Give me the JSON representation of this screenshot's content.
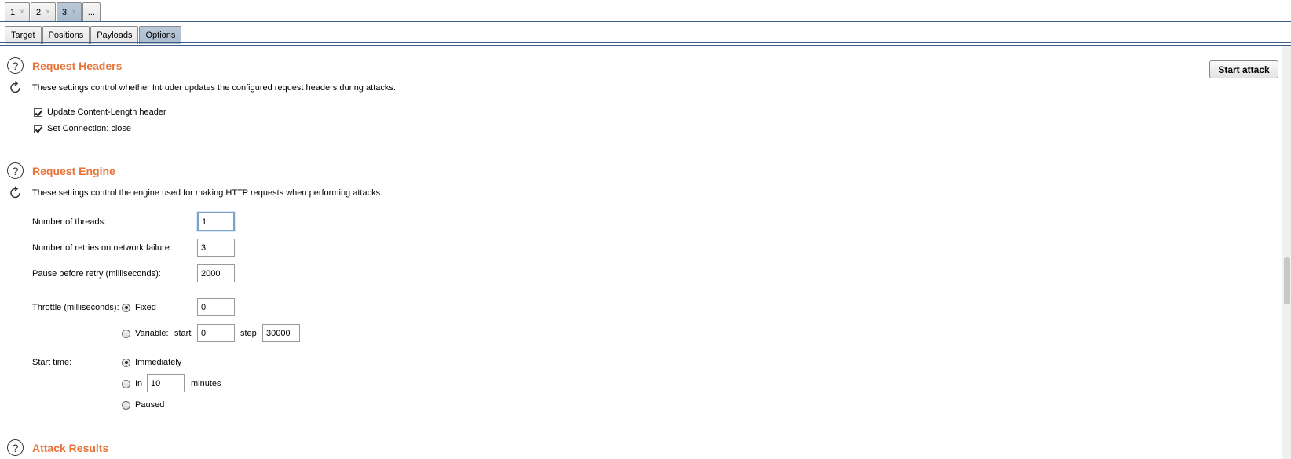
{
  "top_tabs": [
    {
      "label": "1",
      "close": "×"
    },
    {
      "label": "2",
      "close": "×"
    },
    {
      "label": "3",
      "close": "×"
    },
    {
      "label": "..."
    }
  ],
  "sub_tabs": [
    "Target",
    "Positions",
    "Payloads",
    "Options"
  ],
  "start_attack_label": "Start attack",
  "request_headers": {
    "title": "Request Headers",
    "description": "These settings control whether Intruder updates the configured request headers during attacks.",
    "options": [
      {
        "label": "Update Content-Length header",
        "checked": true
      },
      {
        "label": "Set Connection: close",
        "checked": true
      }
    ]
  },
  "request_engine": {
    "title": "Request Engine",
    "description": "These settings control the engine used for making HTTP requests when performing attacks.",
    "threads_label": "Number of threads:",
    "threads_value": "1",
    "retries_label": "Number of retries on network failure:",
    "retries_value": "3",
    "pause_label": "Pause before retry (milliseconds):",
    "pause_value": "2000",
    "throttle_label": "Throttle (milliseconds):",
    "throttle_fixed_label": "Fixed",
    "throttle_fixed_value": "0",
    "throttle_variable_label": "Variable:",
    "throttle_start_label": "start",
    "throttle_start_value": "0",
    "throttle_step_label": "step",
    "throttle_step_value": "30000",
    "start_time_label": "Start time:",
    "start_immediately_label": "Immediately",
    "start_in_label": "In",
    "start_in_value": "10",
    "start_minutes_label": "minutes",
    "start_paused_label": "Paused"
  },
  "attack_results": {
    "title": "Attack Results"
  },
  "icons": [
    "help-icon",
    "refresh-icon",
    "close-icon",
    "checkbox-icon",
    "radio-icon"
  ]
}
